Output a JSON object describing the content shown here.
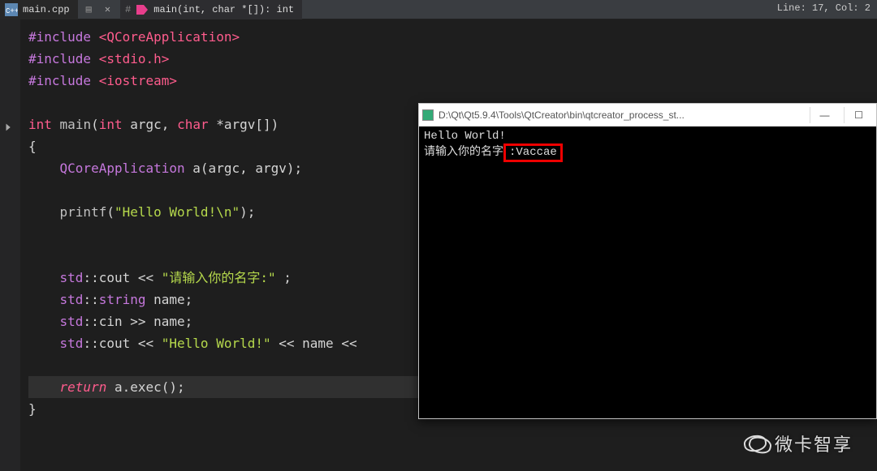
{
  "tabs": {
    "left": {
      "icon": "C++",
      "label": "main.cpp"
    },
    "func": {
      "label": "main(int, char *[]): int",
      "hash": "#"
    }
  },
  "status": {
    "line": "Line: 17, Col: 2"
  },
  "code": {
    "l1a": "#include",
    "l1b": "<QCoreApplication>",
    "l2a": "#include",
    "l2b": "<stdio.h>",
    "l3a": "#include",
    "l3b": "<iostream>",
    "l5a": "int",
    "l5b": "main",
    "l5c": "(",
    "l5d": "int",
    "l5e": " argc, ",
    "l5f": "char",
    "l5g": " *argv[])",
    "l6": "{",
    "l7a": "QCoreApplication",
    "l7b": " a(argc, argv);",
    "l9a": "printf",
    "l9b": "(",
    "l9c": "\"Hello World!\\n\"",
    "l9d": ");",
    "l12a": "std",
    "l12b": "::",
    "l12c": "cout << ",
    "l12d": "\"请输入你的名字:\"",
    "l12e": " ;",
    "l13a": "std",
    "l13b": "::",
    "l13c": "string",
    "l13d": " name;",
    "l14a": "std",
    "l14b": "::",
    "l14c": "cin >> name;",
    "l15a": "std",
    "l15b": "::",
    "l15c": "cout << ",
    "l15d": "\"Hello World!\"",
    "l15e": " << name <<",
    "l17a": "return",
    "l17b": " a.exec();",
    "l18": "}"
  },
  "console": {
    "path": "D:\\Qt\\Qt5.9.4\\Tools\\QtCreator\\bin\\qtcreator_process_st...",
    "out1": "Hello World!",
    "out2a": "请输入你的名字",
    "out2b": ":Vaccae",
    "min": "—",
    "max": "☐"
  },
  "watermark": {
    "text": "微卡智享"
  }
}
